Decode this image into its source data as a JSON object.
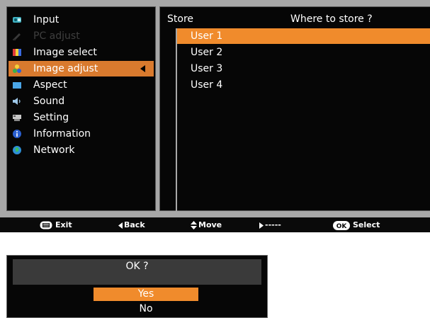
{
  "menu": {
    "items": [
      {
        "label": "Input",
        "icon": "input-icon",
        "state": "normal"
      },
      {
        "label": "PC adjust",
        "icon": "pc-adjust-icon",
        "state": "disabled"
      },
      {
        "label": "Image select",
        "icon": "image-select-icon",
        "state": "normal"
      },
      {
        "label": "Image adjust",
        "icon": "image-adjust-icon",
        "state": "selected"
      },
      {
        "label": "Aspect",
        "icon": "aspect-icon",
        "state": "normal"
      },
      {
        "label": "Sound",
        "icon": "speaker-icon",
        "state": "normal"
      },
      {
        "label": "Setting",
        "icon": "setting-icon",
        "state": "normal"
      },
      {
        "label": "Information",
        "icon": "info-icon",
        "state": "normal"
      },
      {
        "label": "Network",
        "icon": "globe-icon",
        "state": "normal"
      }
    ]
  },
  "submenu": {
    "title": "Store",
    "prompt": "Where to store ?",
    "items": [
      "User 1",
      "User 2",
      "User 3",
      "User 4"
    ],
    "selected_index": 0
  },
  "statusbar": {
    "exit": "Exit",
    "back": "Back",
    "move": "Move",
    "next": "-----",
    "ok_badge": "OK",
    "select": "Select"
  },
  "dialog": {
    "title": "OK ?",
    "options": [
      "Yes",
      "No"
    ],
    "selected_index": 0
  },
  "colors": {
    "accent_orange": "#f08b2c",
    "menu_highlight": "#d97a2e",
    "panel_black": "#060606",
    "frame_gray": "#a7a7a7"
  }
}
